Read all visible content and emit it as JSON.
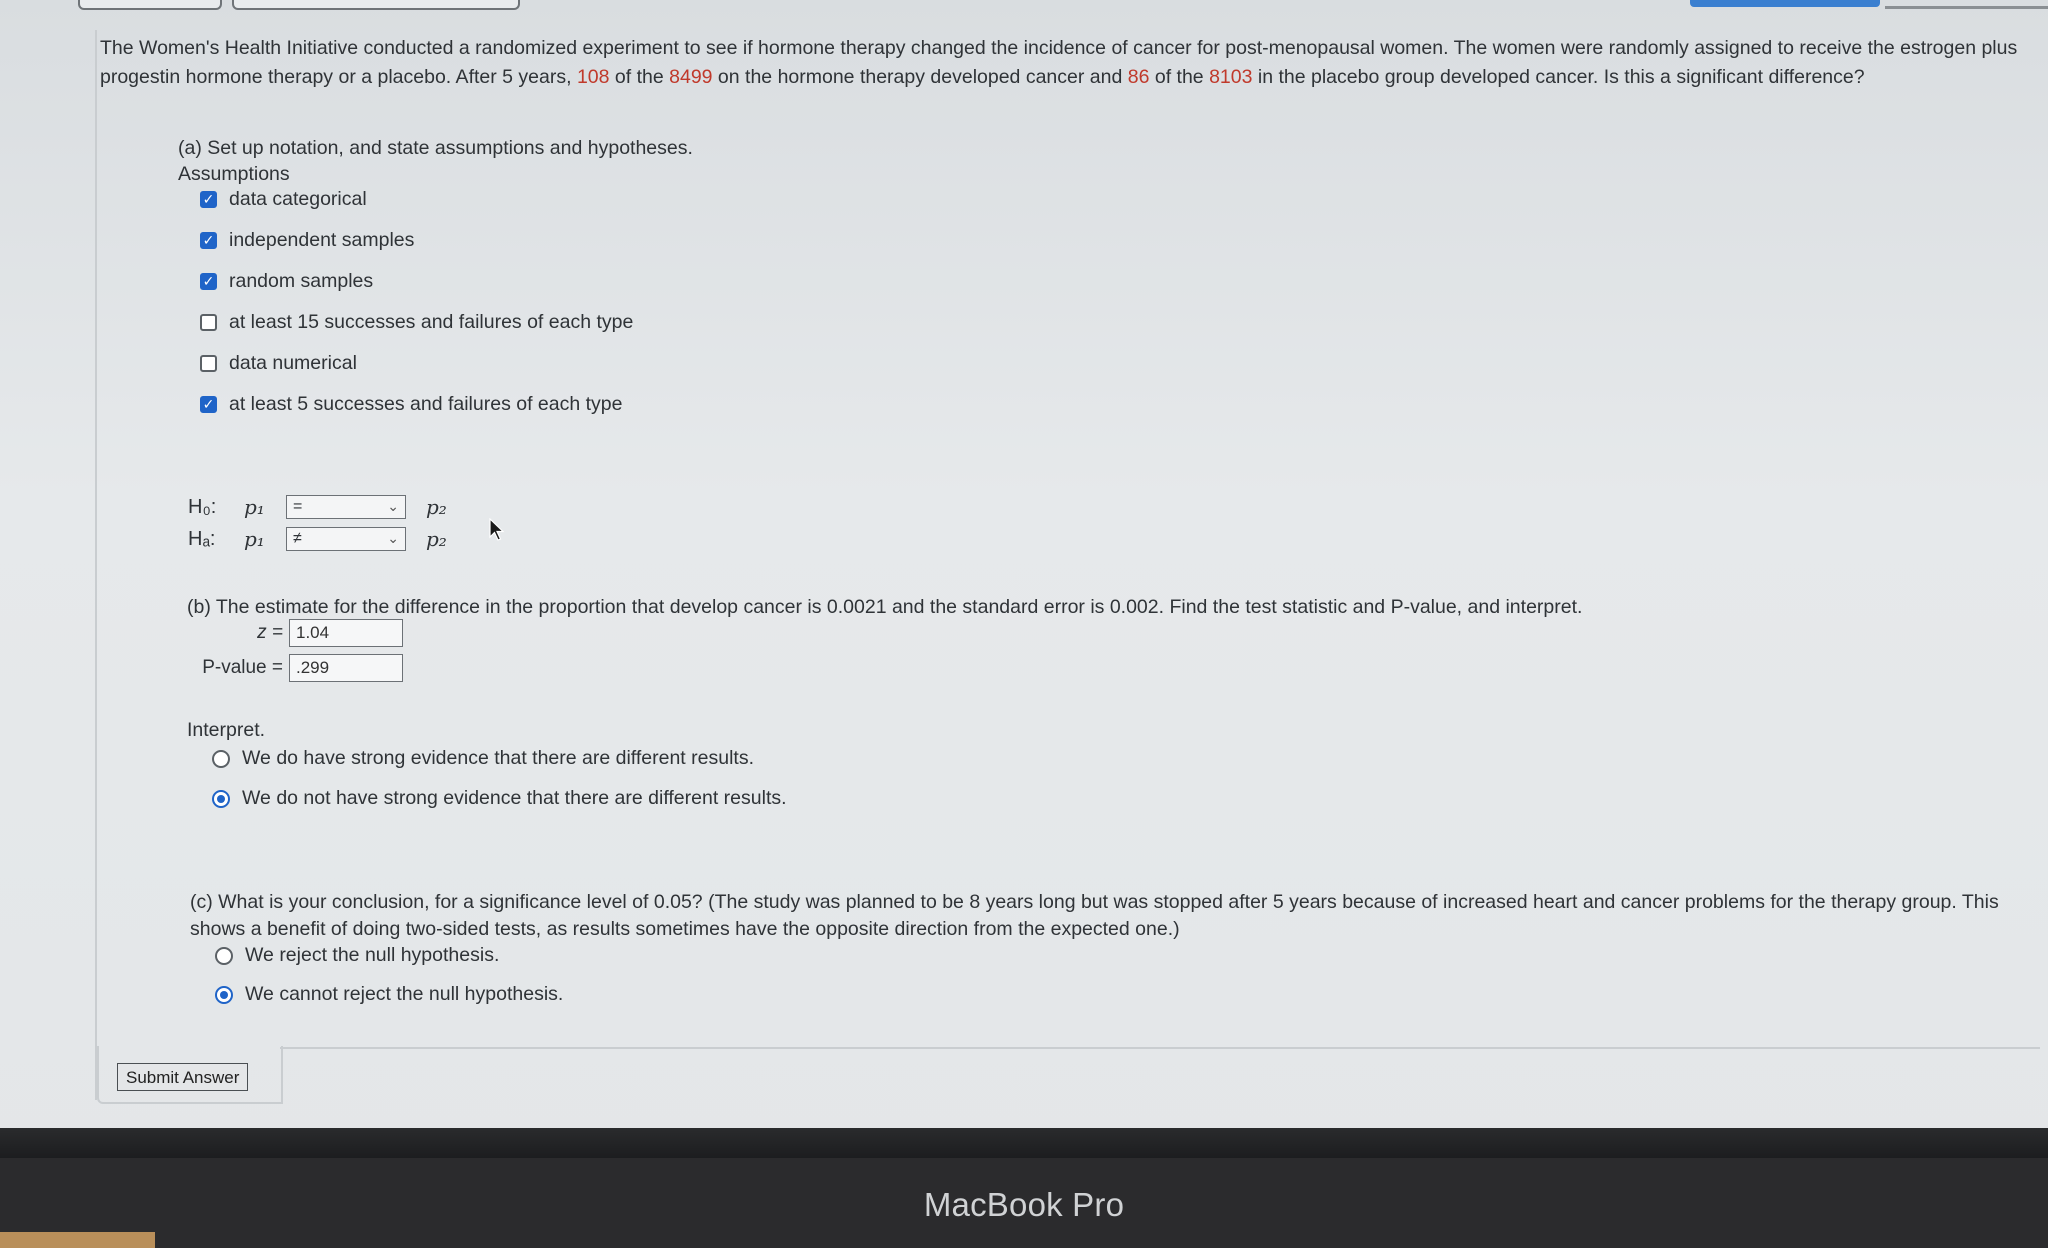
{
  "question": {
    "text_1": "The Women's Health Initiative conducted a randomized experiment to see if hormone therapy changed the incidence of cancer for post-menopausal women. The women were randomly assigned to receive the estrogen plus progestin hormone therapy or a placebo. After 5 years, ",
    "n_therapy_cancer": "108",
    "text_2": " of the ",
    "n_therapy_total": "8499",
    "text_3": " on the hormone therapy developed cancer and ",
    "n_placebo_cancer": "86",
    "text_4": " of the ",
    "n_placebo_total": "8103",
    "text_5": " in the placebo group developed cancer. Is this a significant difference?"
  },
  "part_a": {
    "prompt": "(a) Set up notation, and state assumptions and hypotheses.",
    "assumptions_label": "Assumptions",
    "assumptions": [
      {
        "label": "data categorical",
        "checked": true
      },
      {
        "label": "independent samples",
        "checked": true
      },
      {
        "label": "random samples",
        "checked": true
      },
      {
        "label": "at least 15 successes and failures of each type",
        "checked": false
      },
      {
        "label": "data numerical",
        "checked": false
      },
      {
        "label": "at least 5 successes and failures of each type",
        "checked": true
      }
    ],
    "h0_label": "H₀:",
    "ha_label": "Hₐ:",
    "p1": "p₁",
    "p2": "p₂",
    "h0_select": "=",
    "ha_select": "≠",
    "chevron": "⌄"
  },
  "part_b": {
    "prompt": "(b) The estimate for the difference in the proportion that develop cancer is 0.0021 and the standard error is 0.002. Find the test statistic and P-value, and interpret.",
    "z_label": "z =",
    "z_value": "1.04",
    "p_label": "P-value =",
    "p_value": ".299",
    "interpret_label": "Interpret.",
    "options": [
      {
        "label": "We do have strong evidence that there are different results.",
        "selected": false
      },
      {
        "label": "We do not have strong evidence that there are different results.",
        "selected": true
      }
    ]
  },
  "part_c": {
    "prompt": "(c) What is your conclusion, for a significance level of 0.05? (The study was planned to be 8 years long but was stopped after 5 years because of increased heart and cancer problems for the therapy group. This shows a benefit of doing two-sided tests, as results sometimes have the opposite direction from the expected one.)",
    "options": [
      {
        "label": "We reject the null hypothesis.",
        "selected": false
      },
      {
        "label": "We cannot reject the null hypothesis.",
        "selected": true
      }
    ]
  },
  "submit_label": "Submit Answer",
  "bezel_label": "MacBook Pro",
  "colors": {
    "accent": "#1f64c8",
    "highlight": "#c0392b"
  }
}
